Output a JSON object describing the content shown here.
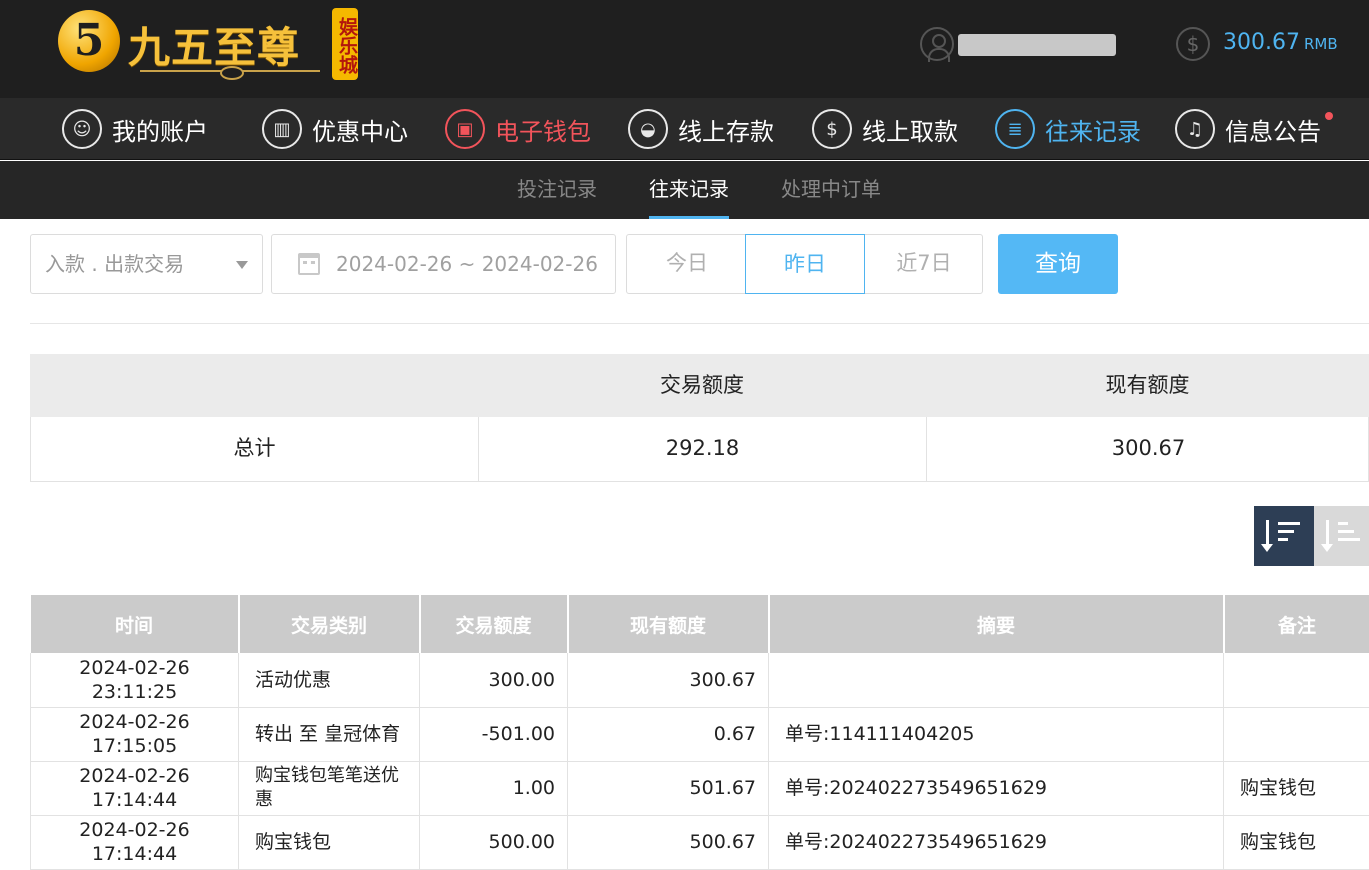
{
  "header": {
    "logo_digit": "5",
    "logo_text": "九五至尊",
    "logo_badge": "娱乐城",
    "balance_value": "300.67",
    "balance_unit": "RMB"
  },
  "main_nav": [
    {
      "label": "我的账户",
      "icon": "user-icon"
    },
    {
      "label": "优惠中心",
      "icon": "gift-icon"
    },
    {
      "label": "电子钱包",
      "icon": "wallet-icon"
    },
    {
      "label": "线上存款",
      "icon": "deposit-icon"
    },
    {
      "label": "线上取款",
      "icon": "withdraw-icon"
    },
    {
      "label": "往来记录",
      "icon": "records-icon"
    },
    {
      "label": "信息公告",
      "icon": "bell-icon"
    }
  ],
  "sub_nav": [
    {
      "label": "投注记录"
    },
    {
      "label": "往来记录"
    },
    {
      "label": "处理中订单"
    }
  ],
  "filter": {
    "type_value": "入款 . 出款交易",
    "date_range": "2024-02-26 ~ 2024-02-26",
    "range_buttons": [
      "今日",
      "昨日",
      "近7日"
    ],
    "query_label": "查询"
  },
  "summary": {
    "headers": [
      "",
      "交易额度",
      "现有额度"
    ],
    "row": [
      "总计",
      "292.18",
      "300.67"
    ]
  },
  "records": {
    "headers": [
      "时间",
      "交易类别",
      "交易额度",
      "现有额度",
      "摘要",
      "备注"
    ],
    "rows": [
      [
        "2024-02-26 23:11:25",
        "活动优惠",
        "300.00",
        "300.67",
        "",
        ""
      ],
      [
        "2024-02-26 17:15:05",
        "转出 至 皇冠体育",
        "-501.00",
        "0.67",
        "单号:114111404205",
        ""
      ],
      [
        "2024-02-26 17:14:44",
        "购宝钱包笔笔送优惠",
        "1.00",
        "501.67",
        "单号:20240227354965162​9",
        "购宝钱包"
      ],
      [
        "2024-02-26 17:14:44",
        "购宝钱包",
        "500.00",
        "500.67",
        "单号:202402273549651629",
        "购宝钱包"
      ]
    ]
  },
  "colors": {
    "accent": "#4fb4f0",
    "alert": "#f2545b",
    "header_bg": "#1f1f1f"
  }
}
